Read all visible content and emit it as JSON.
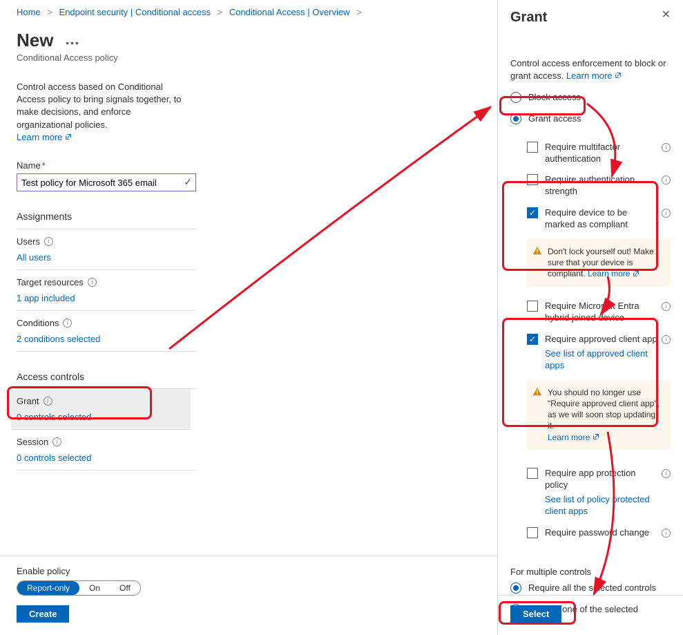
{
  "breadcrumbs": {
    "home": "Home",
    "ep": "Endpoint security | Conditional access",
    "ca": "Conditional Access | Overview"
  },
  "page": {
    "title": "New",
    "subtitle": "Conditional Access policy",
    "intro": "Control access based on Conditional Access policy to bring signals together, to make decisions, and enforce organizational policies.",
    "learn_more": "Learn more"
  },
  "name_field": {
    "label": "Name",
    "value": "Test policy for Microsoft 365 email"
  },
  "sections": {
    "assignments": "Assignments",
    "access_controls": "Access controls"
  },
  "assign": {
    "users_label": "Users",
    "users_value": "All users",
    "target_label": "Target resources",
    "target_value": "1 app included",
    "cond_label": "Conditions",
    "cond_value": "2 conditions selected"
  },
  "controls": {
    "grant_label": "Grant",
    "grant_value": "0 controls selected",
    "session_label": "Session",
    "session_value": "0 controls selected"
  },
  "enable": {
    "label": "Enable policy",
    "opt1": "Report-only",
    "opt2": "On",
    "opt3": "Off",
    "create": "Create"
  },
  "panel": {
    "title": "Grant",
    "intro": "Control access enforcement to block or grant access.",
    "learn_more": "Learn more",
    "block": "Block access",
    "grant": "Grant access",
    "mfa": "Require multifactor authentication",
    "auth_strength": "Require authentication strength",
    "compliant": "Require device to be marked as compliant",
    "compliant_warn": "Don't lock yourself out! Make sure that your device is compliant.",
    "warn_learn_more": "Learn more",
    "hybrid": "Require Microsoft Entra hybrid joined device",
    "approved_app": "Require approved client app",
    "approved_link": "See list of approved client apps",
    "approved_warn": "You should no longer use \"Require approved client app\", as we will soon stop updating it.",
    "app_protection": "Require app protection policy",
    "app_protection_link": "See list of policy protected client apps",
    "pw_change": "Require password change",
    "multi_label": "For multiple controls",
    "multi_all": "Require all the selected controls",
    "multi_one": "Require one of the selected controls",
    "select": "Select"
  }
}
